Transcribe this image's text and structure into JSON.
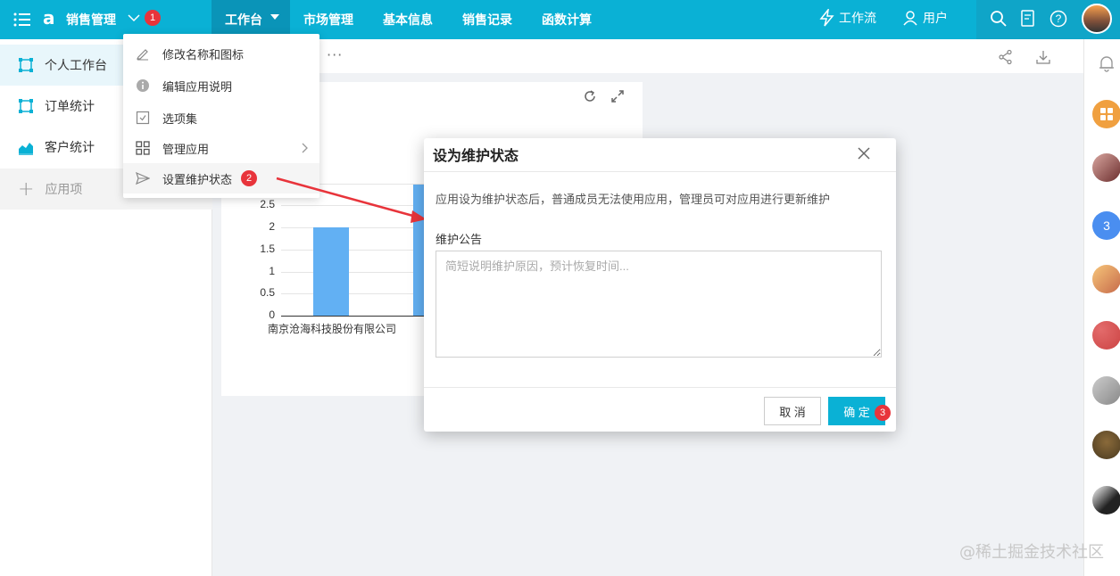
{
  "topbar": {
    "app_name": "销售管理",
    "logo": "a",
    "tabs": [
      {
        "label": "工作台",
        "active": true
      },
      {
        "label": "市场管理"
      },
      {
        "label": "基本信息"
      },
      {
        "label": "销售记录"
      },
      {
        "label": "函数计算"
      }
    ],
    "workflow_label": "工作流",
    "user_label": "用户",
    "accent_color": "#0ab1d5"
  },
  "annotations": {
    "badge1": "1",
    "badge2": "2",
    "badge3": "3"
  },
  "sidebar": {
    "items": [
      {
        "label": "个人工作台",
        "icon": "frame-icon",
        "active": true
      },
      {
        "label": "订单统计",
        "icon": "frame-icon"
      },
      {
        "label": "客户统计",
        "icon": "area-chart-icon"
      }
    ],
    "add_label": "应用项"
  },
  "content": {
    "more": "···"
  },
  "dropdown": {
    "items": [
      {
        "label": "修改名称和图标",
        "icon": "edit-icon"
      },
      {
        "label": "编辑应用说明",
        "icon": "info-icon"
      },
      {
        "label": "选项集",
        "icon": "checkbox-icon"
      },
      {
        "label": "管理应用",
        "icon": "grid-icon"
      },
      {
        "label": "设置维护状态",
        "icon": "send-icon"
      }
    ]
  },
  "chart_data": {
    "type": "bar",
    "categories": [
      "南京沧海科技股份有限公司"
    ],
    "series": [
      {
        "values": [
          2
        ]
      }
    ],
    "yticks": [
      "0",
      "0.5",
      "1",
      "1.5",
      "2",
      "2.5"
    ],
    "ylim": [
      0,
      3
    ]
  },
  "modal": {
    "title": "设为维护状态",
    "description": "应用设为维护状态后，普通成员无法使用应用，管理员可对应用进行更新维护",
    "notice_label": "维护公告",
    "notice_placeholder": "简短说明维护原因，预计恢复时间...",
    "cancel_label": "取 消",
    "ok_label": "确 定"
  },
  "rail": {
    "badge_count": "3"
  },
  "watermark": "@稀土掘金技术社区"
}
